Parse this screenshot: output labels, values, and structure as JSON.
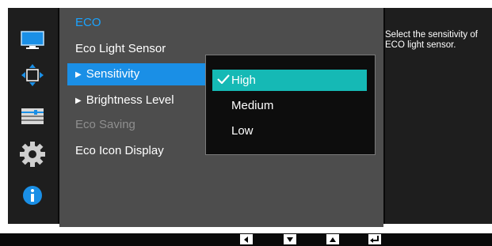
{
  "menu": {
    "title": "ECO",
    "items": [
      {
        "label": "Eco Light Sensor",
        "arrow": false,
        "state": "normal"
      },
      {
        "label": "Sensitivity",
        "arrow": true,
        "state": "active"
      },
      {
        "label": "Brightness Level",
        "arrow": true,
        "state": "normal"
      },
      {
        "label": "Eco Saving",
        "arrow": false,
        "state": "disabled"
      },
      {
        "label": "Eco Icon Display",
        "arrow": false,
        "state": "normal"
      }
    ]
  },
  "submenu": {
    "options": [
      {
        "label": "High",
        "selected": true
      },
      {
        "label": "Medium",
        "selected": false
      },
      {
        "label": "Low",
        "selected": false
      }
    ]
  },
  "help": {
    "text": "Select the sensitivity of ECO light sensor."
  },
  "sidebar": {
    "icons": [
      "monitor-icon",
      "position-icon",
      "settings-sliders-icon",
      "gear-icon",
      "info-icon"
    ]
  },
  "nav_keys": [
    "left-arrow-key-icon",
    "down-arrow-key-icon",
    "up-arrow-key-icon",
    "enter-key-icon"
  ],
  "colors": {
    "accent_blue": "#1a8fe6",
    "selected_teal": "#15b9b5",
    "title_blue": "#1aa3ff"
  }
}
